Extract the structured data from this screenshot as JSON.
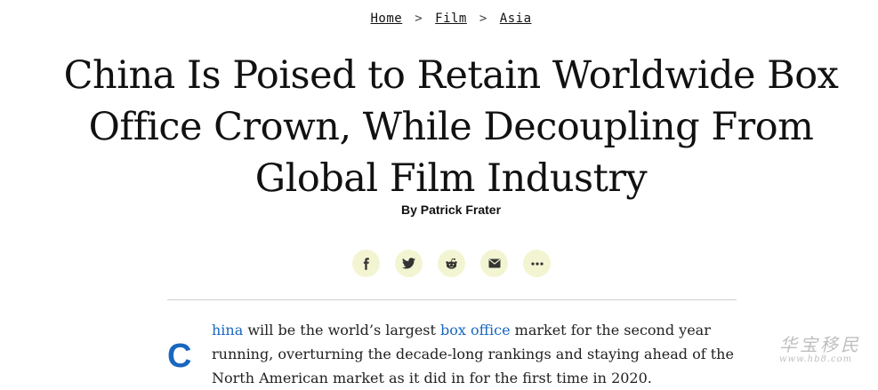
{
  "breadcrumb": {
    "items": [
      "Home",
      "Film",
      "Asia"
    ],
    "separator": ">"
  },
  "article": {
    "headline_lines": [
      "China Is Poised to Retain Worldwide Box",
      "Office Crown, While Decoupling From",
      "Global Film Industry"
    ],
    "byline": "By Patrick Frater",
    "dropcap": "C",
    "body": {
      "seg1": "hina",
      "seg2": " will be the world’s largest ",
      "seg3": "box office",
      "seg4": " market for the second year running, overturning the decade-long rankings and staying ahead of the North American market as it did in for the first time in 2020."
    }
  },
  "share": {
    "icons": [
      "facebook-icon",
      "twitter-icon",
      "reddit-icon",
      "email-icon",
      "more-icon"
    ]
  },
  "watermark": {
    "title": "华宝移民",
    "url": "www.hb8.com"
  },
  "colors": {
    "accent": "#1867c0",
    "share_bg": "#f3f5d2",
    "text": "#111111"
  }
}
